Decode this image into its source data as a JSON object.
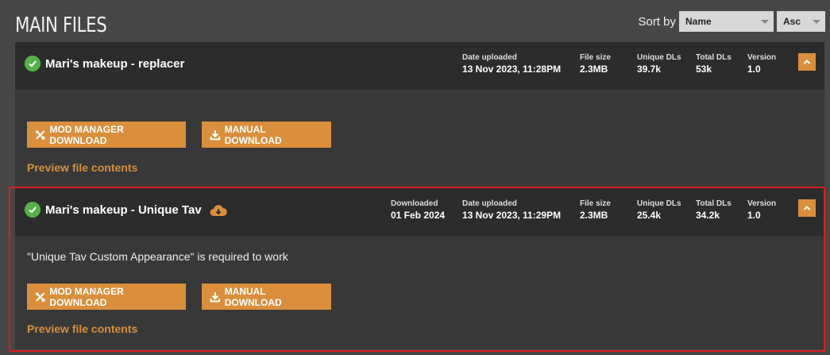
{
  "section_title": "MAIN FILES",
  "sort": {
    "label": "Sort by",
    "field": "Name",
    "order": "Asc"
  },
  "files": [
    {
      "name": "Mari's makeup - replacer",
      "date_uploaded_label": "Date uploaded",
      "date_uploaded": "13 Nov 2023, 11:28PM",
      "file_size_label": "File size",
      "file_size": "2.3MB",
      "unique_dls_label": "Unique DLs",
      "unique_dls": "39.7k",
      "total_dls_label": "Total DLs",
      "total_dls": "53k",
      "version_label": "Version",
      "version": "1.0",
      "mod_manager_label": "MOD MANAGER DOWNLOAD",
      "manual_label": "MANUAL DOWNLOAD",
      "preview_label": "Preview file contents"
    },
    {
      "name": "Mari's makeup - Unique Tav",
      "downloaded_label": "Downloaded",
      "downloaded": "01 Feb 2024",
      "date_uploaded_label": "Date uploaded",
      "date_uploaded": "13 Nov 2023, 11:29PM",
      "file_size_label": "File size",
      "file_size": "2.3MB",
      "unique_dls_label": "Unique DLs",
      "unique_dls": "25.4k",
      "total_dls_label": "Total DLs",
      "total_dls": "34.2k",
      "version_label": "Version",
      "version": "1.0",
      "requirement": "\"Unique Tav Custom Appearance\" is required to work",
      "mod_manager_label": "MOD MANAGER DOWNLOAD",
      "manual_label": "MANUAL DOWNLOAD",
      "preview_label": "Preview file contents"
    }
  ],
  "colors": {
    "accent": "#d98f3c",
    "check": "#56b14a",
    "highlight": "#d81e1e"
  }
}
